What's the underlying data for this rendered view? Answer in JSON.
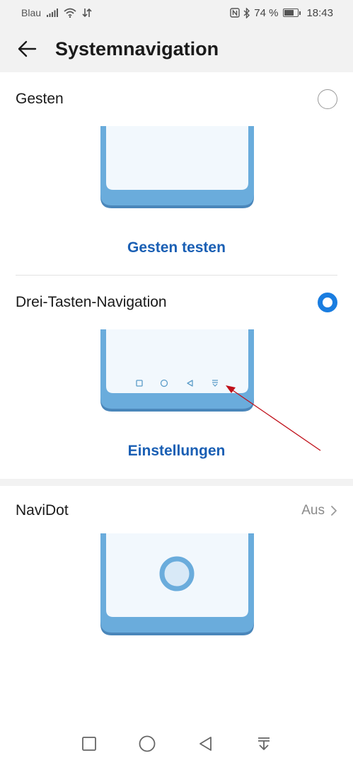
{
  "status_bar": {
    "carrier": "Blau",
    "battery_percent": "74 %",
    "battery_level": 0.74,
    "time": "18:43",
    "icons": [
      "signal-icon",
      "wifi-icon",
      "data-transfer-icon",
      "nfc-icon",
      "bluetooth-icon",
      "battery-icon"
    ]
  },
  "header": {
    "title": "Systemnavigation",
    "back_icon": "arrow-left-icon"
  },
  "options": {
    "gestures": {
      "label": "Gesten",
      "selected": false,
      "action_label": "Gesten testen"
    },
    "three_key": {
      "label": "Drei-Tasten-Navigation",
      "selected": true,
      "action_label": "Einstellungen",
      "preview_icons": [
        "square-icon",
        "circle-icon",
        "triangle-back-icon",
        "notification-pull-icon"
      ]
    },
    "navidot": {
      "label": "NaviDot",
      "value": "Aus"
    }
  },
  "nav_bar": {
    "icons": [
      "recent-apps-icon",
      "home-icon",
      "back-icon",
      "notification-pull-icon"
    ]
  },
  "colors": {
    "accent": "#1a7de0",
    "link": "#1a5fb4",
    "phone_frame": "#6aacdc",
    "phone_frame_dark": "#4a86ba",
    "phone_screen": "#f2f8fd",
    "annotation_arrow": "#c0101a"
  }
}
